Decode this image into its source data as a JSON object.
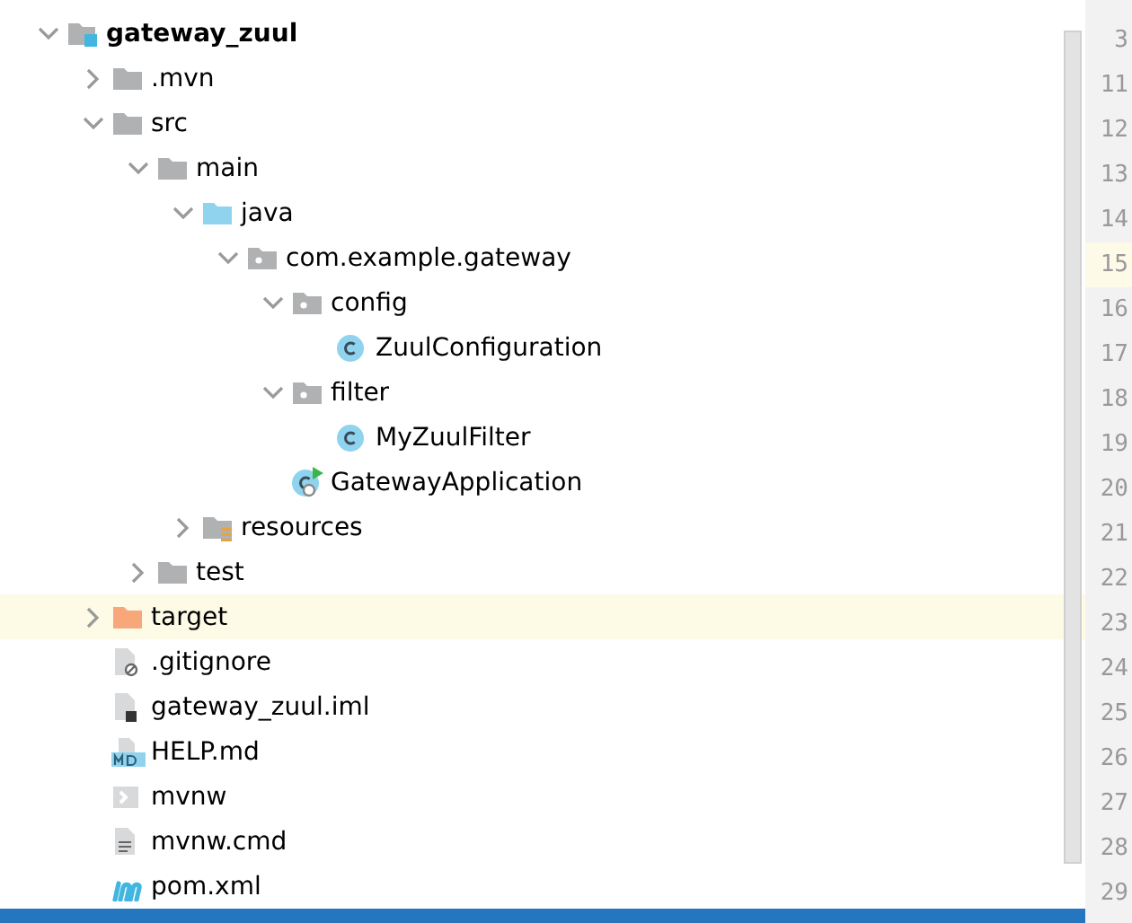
{
  "tree": [
    {
      "label": "gateway_zuul",
      "kind": "module",
      "expanded": true,
      "highlighted": false,
      "children": [
        {
          "label": ".mvn",
          "kind": "folder",
          "expanded": false,
          "highlighted": false
        },
        {
          "label": "src",
          "kind": "folder",
          "expanded": true,
          "highlighted": false,
          "children": [
            {
              "label": "main",
              "kind": "folder",
              "expanded": true,
              "highlighted": false,
              "children": [
                {
                  "label": "java",
                  "kind": "source-folder",
                  "expanded": true,
                  "highlighted": false,
                  "children": [
                    {
                      "label": "com.example.gateway",
                      "kind": "package",
                      "expanded": true,
                      "highlighted": false,
                      "children": [
                        {
                          "label": "config",
                          "kind": "package",
                          "expanded": true,
                          "highlighted": false,
                          "children": [
                            {
                              "label": "ZuulConfiguration",
                              "kind": "class",
                              "highlighted": false
                            }
                          ]
                        },
                        {
                          "label": "filter",
                          "kind": "package",
                          "expanded": true,
                          "highlighted": false,
                          "children": [
                            {
                              "label": "MyZuulFilter",
                              "kind": "class",
                              "highlighted": false
                            }
                          ]
                        },
                        {
                          "label": "GatewayApplication",
                          "kind": "main-class",
                          "highlighted": false
                        }
                      ]
                    }
                  ]
                },
                {
                  "label": "resources",
                  "kind": "resources-folder",
                  "expanded": false,
                  "highlighted": false
                }
              ]
            },
            {
              "label": "test",
              "kind": "folder",
              "expanded": false,
              "highlighted": false
            }
          ]
        },
        {
          "label": "target",
          "kind": "excluded-folder",
          "expanded": false,
          "highlighted": true
        },
        {
          "label": ".gitignore",
          "kind": "ignore-file",
          "highlighted": false
        },
        {
          "label": "gateway_zuul.iml",
          "kind": "iml-file",
          "highlighted": false
        },
        {
          "label": "HELP.md",
          "kind": "markdown-file",
          "highlighted": false
        },
        {
          "label": "mvnw",
          "kind": "shell-file",
          "highlighted": false
        },
        {
          "label": "mvnw.cmd",
          "kind": "text-file",
          "highlighted": false
        },
        {
          "label": "pom.xml",
          "kind": "maven-file",
          "highlighted": false
        }
      ]
    }
  ],
  "cut_row": {
    "selected": true
  },
  "gutter": [
    {
      "number": "3",
      "current": false
    },
    {
      "number": "11",
      "current": false
    },
    {
      "number": "12",
      "current": false
    },
    {
      "number": "13",
      "current": false
    },
    {
      "number": "14",
      "current": false
    },
    {
      "number": "15",
      "current": true
    },
    {
      "number": "16",
      "current": false
    },
    {
      "number": "17",
      "current": false
    },
    {
      "number": "18",
      "current": false
    },
    {
      "number": "19",
      "current": false
    },
    {
      "number": "20",
      "current": false
    },
    {
      "number": "21",
      "current": false
    },
    {
      "number": "22",
      "current": false
    },
    {
      "number": "23",
      "current": false
    },
    {
      "number": "24",
      "current": false
    },
    {
      "number": "25",
      "current": false
    },
    {
      "number": "26",
      "current": false
    },
    {
      "number": "27",
      "current": false
    },
    {
      "number": "28",
      "current": false
    },
    {
      "number": "29",
      "current": false
    }
  ]
}
